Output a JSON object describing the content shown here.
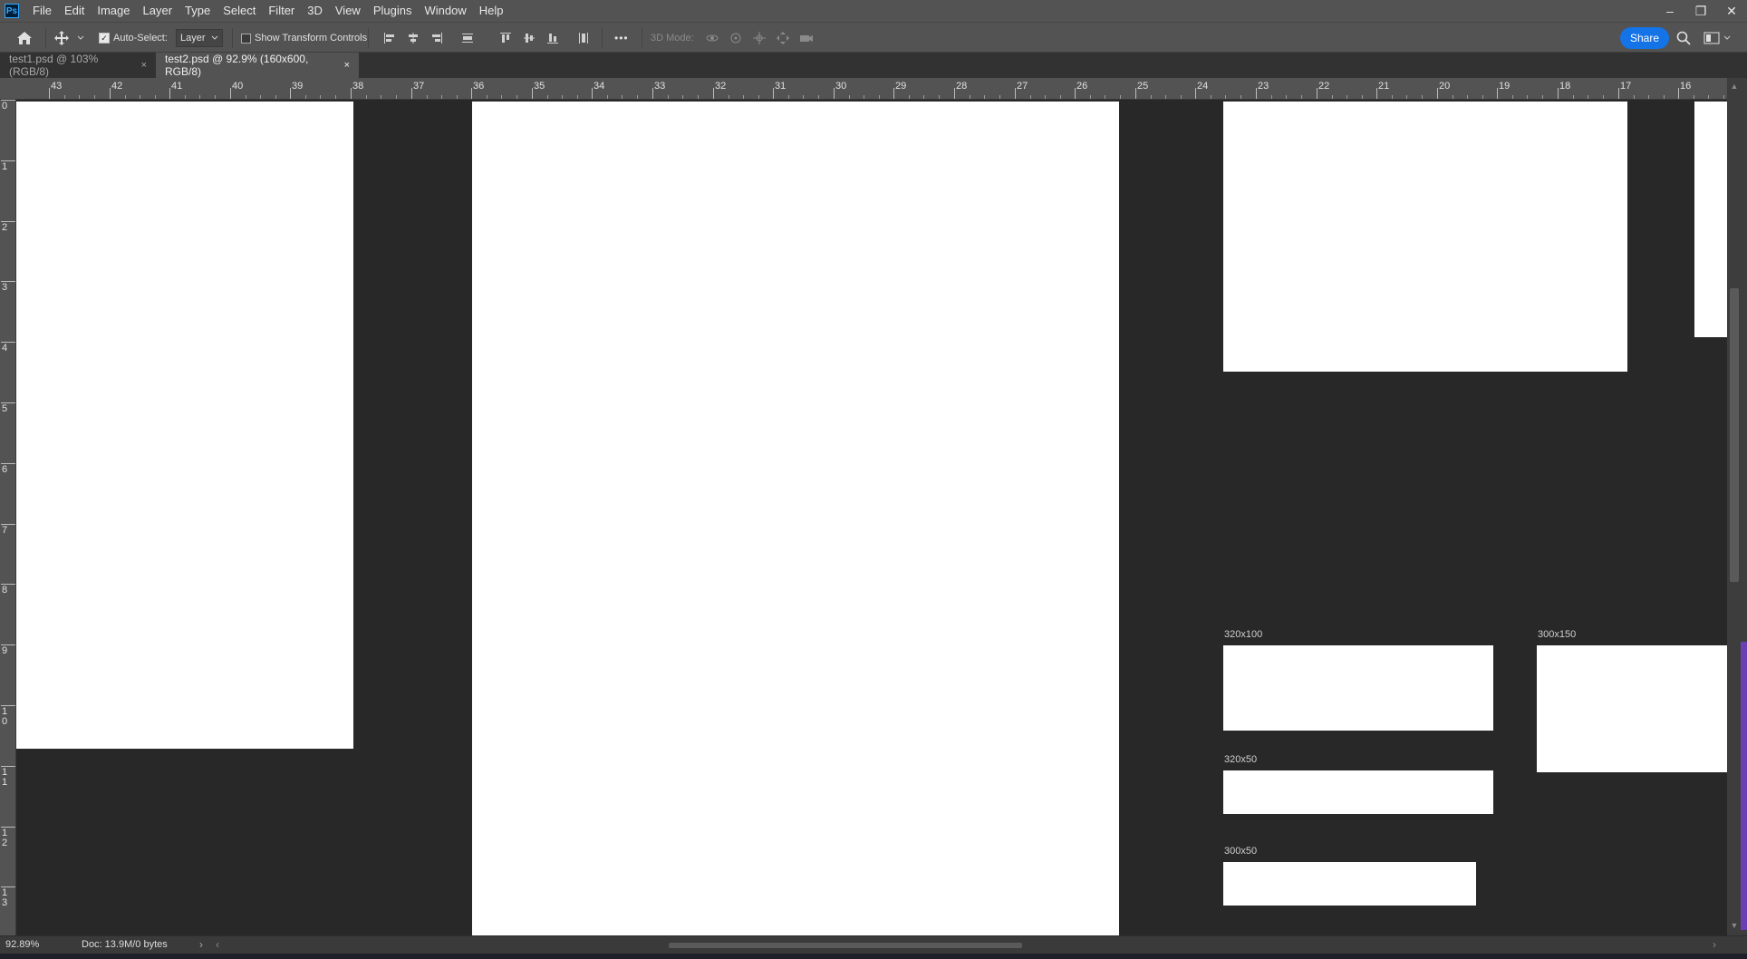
{
  "app": {
    "logo_text": "Ps"
  },
  "menu": [
    "File",
    "Edit",
    "Image",
    "Layer",
    "Type",
    "Select",
    "Filter",
    "3D",
    "View",
    "Plugins",
    "Window",
    "Help"
  ],
  "window_controls": {
    "minimize": "–",
    "restore": "❐",
    "close": "✕"
  },
  "options": {
    "auto_select_label": "Auto-Select:",
    "auto_select_checked": "✓",
    "layer_dropdown": "Layer",
    "show_transform_label": "Show Transform Controls",
    "more_label": "•••",
    "mode_3d_label": "3D Mode:",
    "share_label": "Share"
  },
  "tabs": [
    {
      "label": "test1.psd @ 103% (RGB/8)",
      "close": "×",
      "active": false
    },
    {
      "label": "test2.psd @ 92.9% (160x600, RGB/8)",
      "close": "×",
      "active": true
    }
  ],
  "ruler_h": [
    "43",
    "42",
    "41",
    "40",
    "39",
    "38",
    "37",
    "36",
    "35",
    "34",
    "33",
    "32",
    "31",
    "30",
    "29",
    "28",
    "27",
    "26",
    "25",
    "24",
    "23",
    "22",
    "21",
    "20",
    "19",
    "18",
    "17",
    "16"
  ],
  "ruler_v": [
    "0",
    "1",
    "2",
    "3",
    "4",
    "5",
    "6",
    "7",
    "8",
    "9",
    "1\n0",
    "1\n1",
    "1\n2",
    "1\n3"
  ],
  "artboards": {
    "label_320x100": "320x100",
    "label_300x150": "300x150",
    "label_320x50": "320x50",
    "label_300x50": "300x50"
  },
  "status": {
    "zoom": "92.89%",
    "doc": "Doc: 13.9M/0 bytes",
    "arrow": "›"
  },
  "colors": {
    "accent": "#1473e6",
    "panel": "#535353",
    "canvas": "#282828"
  }
}
